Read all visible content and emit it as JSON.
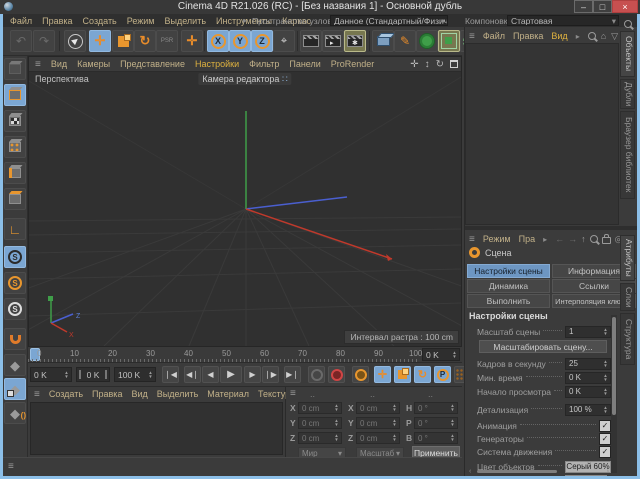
{
  "colors": {
    "accent": "#e8962e",
    "selection": "#7ba6d2",
    "menu_highlight": "#dfb23f",
    "window_border": "#8cbfe8"
  },
  "titlebar": {
    "title": "Cinema 4D R21.026 (RC) - [Без названия 1] - Основной дубль",
    "minimize": "–",
    "maximize": "□",
    "close": "×"
  },
  "menubar": {
    "items": [
      "Файл",
      "Правка",
      "Создать",
      "Режим",
      "Выделить",
      "Инструменты",
      "Каркас"
    ],
    "node_space_label": "Пространство узлов:",
    "node_space_value": "Данное (Стандартный/Физический)",
    "layout_label": "Компоновка",
    "layout_value": "Стартовая"
  },
  "toolbar": {
    "undo": "↶",
    "redo": "↷",
    "psr": "PSR",
    "last_tool": "✛",
    "move": "✛",
    "rotate": "↻",
    "axis_x": "X",
    "axis_y": "Y",
    "axis_z": "Z",
    "coord_sys": "⌖",
    "pen": "✎"
  },
  "viewport": {
    "menus": [
      "Вид",
      "Камеры",
      "Представление",
      "Настройки",
      "Фильтр",
      "Панели",
      "ProRender"
    ],
    "active_menu": "Настройки",
    "view_label": "Перспектива",
    "camera_label": "Камера редактора",
    "camera_icon": "∷",
    "grid_interval": "Интервал растра : 100 cm",
    "nav_pan": "✛",
    "nav_zoom": "↕",
    "nav_rotate": "↻",
    "axis_x_label": "X",
    "axis_z_label": "Z"
  },
  "timeline": {
    "ticks": [
      "0",
      "10",
      "20",
      "30",
      "40",
      "50",
      "60",
      "70",
      "80",
      "90",
      "100"
    ],
    "frame_field": "0 K"
  },
  "transport": {
    "current": "0 K",
    "range_start": "0 K",
    "range_end": "100 K",
    "go_start": "❘◀",
    "prev_key": "◀❘",
    "prev_frame": "◀",
    "play": "▶",
    "next_frame": "▶",
    "next_key": "❘▶",
    "go_end": "▶❘",
    "move": "✛",
    "rotate": "↻",
    "param": "P"
  },
  "materials": {
    "menus": [
      "Создать",
      "Правка",
      "Вид",
      "Выделить",
      "Материал",
      "Текстура"
    ]
  },
  "coordinates": {
    "headers": [
      "..",
      "..",
      ".."
    ],
    "position": {
      "labels": [
        "X",
        "Y",
        "Z"
      ],
      "values": [
        "0 cm",
        "0 cm",
        "0 cm"
      ],
      "mode": "Мир"
    },
    "scale": {
      "labels": [
        "X",
        "Y",
        "Z"
      ],
      "values": [
        "0 cm",
        "0 cm",
        "0 cm"
      ],
      "mode": "Масштаб"
    },
    "rotation": {
      "labels": [
        "H",
        "P",
        "B"
      ],
      "values": [
        "0 °",
        "0 °",
        "0 °"
      ],
      "apply_label": "Применить"
    }
  },
  "object_manager": {
    "menus": [
      "Файл",
      "Правка",
      "Вид"
    ],
    "home_icon": "⌂",
    "filter_icon": "▽",
    "add_icon": "⊞",
    "tabs": [
      "Объекты",
      "Дубли",
      "Браузер библиотек"
    ]
  },
  "attributes": {
    "menus": [
      "Режим",
      "Пра"
    ],
    "nav_left": "←",
    "nav_right": "→",
    "nav_up": "↑",
    "target_icon": "◎",
    "add_icon": "⊞",
    "tabs": [
      "Атрибуты",
      "Слои",
      "Структура"
    ],
    "object_label": "Сцена",
    "mode_buttons": [
      "Настройки сцены",
      "Информация",
      "Динамика",
      "Ссылки",
      "Выполнить",
      "Интерполяция ключей"
    ],
    "active_mode_button": "Настройки сцены",
    "section_title": "Настройки сцены",
    "scene_scale_label": "Масштаб сцены",
    "scene_scale_value": "1",
    "scale_button": "Масштабировать сцену...",
    "fps_label": "Кадров в секунду",
    "fps_value": "25",
    "min_time_label": "Мин. время",
    "min_time_value": "0 K",
    "preview_start_label": "Начало просмотра",
    "preview_start_value": "0 K",
    "lod_label": "Детализация",
    "lod_value": "100 %",
    "animation_label": "Анимация",
    "generators_label": "Генераторы",
    "motion_label": "Система движения",
    "check_glyph": "✓",
    "object_color_label": "Цвет объектов",
    "object_color_value": "Серый 60%"
  }
}
